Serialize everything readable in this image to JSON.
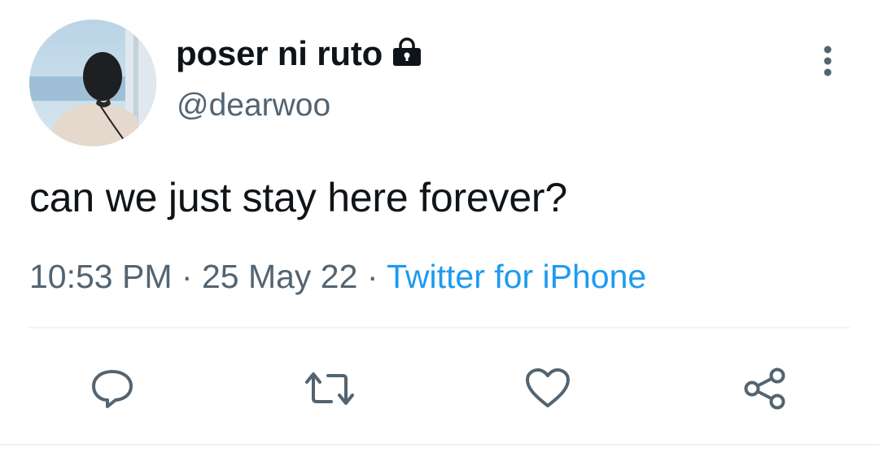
{
  "tweet": {
    "author": {
      "display_name": "poser ni ruto",
      "handle": "@dearwoo",
      "protected_icon": "lock-icon"
    },
    "text": "can we just stay here forever?",
    "time": "10:53 PM",
    "date": "25 May 22",
    "separator": "·",
    "source": "Twitter for iPhone"
  },
  "actions": {
    "reply_icon": "reply-icon",
    "retweet_icon": "retweet-icon",
    "like_icon": "heart-icon",
    "share_icon": "share-icon"
  },
  "colors": {
    "text_primary": "#0f1419",
    "text_secondary": "#536471",
    "link": "#1d9bf0",
    "divider": "#eff3f4"
  }
}
